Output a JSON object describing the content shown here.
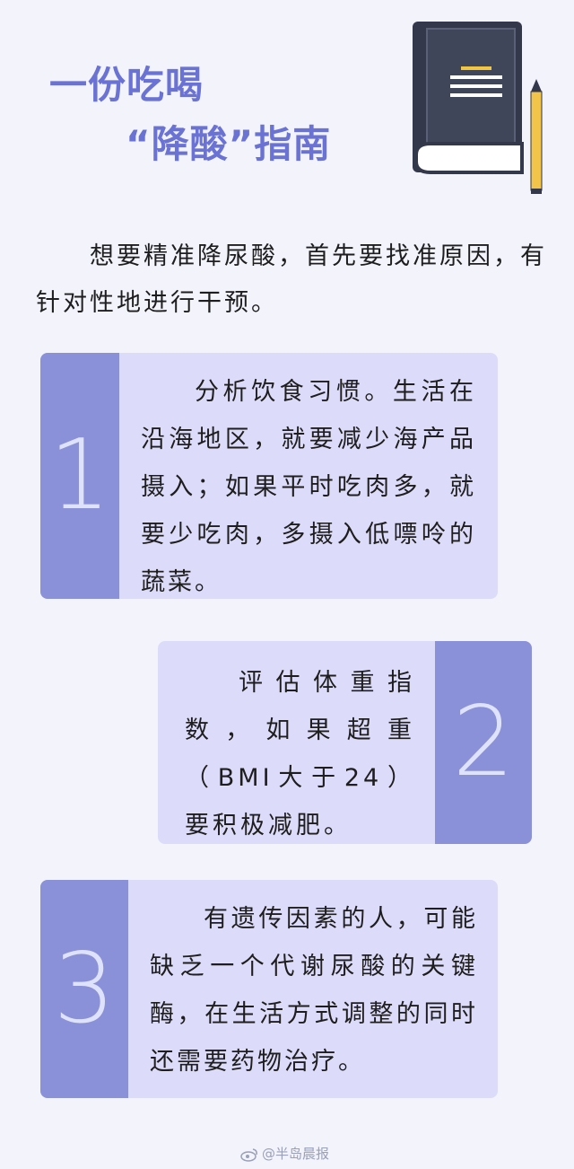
{
  "title": {
    "line1": "一份吃喝",
    "line2": "“降酸”指南"
  },
  "intro": "想要精准降尿酸，首先要找准原因，有针对性地进行干预。",
  "cards": [
    {
      "number": "1",
      "text": "分析饮食习惯。生活在沿海地区，就要减少海产品摄入；如果平时吃肉多，就要少吃肉，多摄入低嘌呤的蔬菜。"
    },
    {
      "number": "2",
      "text": "评估体重指数，如果超重（BMI大于24）要积极减肥。"
    },
    {
      "number": "3",
      "text": "有遗传因素的人，可能缺乏一个代谢尿酸的关键酶，在生活方式调整的同时还需要药物治疗。"
    }
  ],
  "watermark": "@半岛晨报",
  "icons": {
    "book": "book-icon",
    "pencil": "pencil-icon",
    "weibo": "weibo-icon"
  },
  "colors": {
    "accent": "#6a72d4",
    "card_bg": "#dcdcfa",
    "number_bg": "#8a91d8",
    "page_bg": "#f2f3fb"
  }
}
